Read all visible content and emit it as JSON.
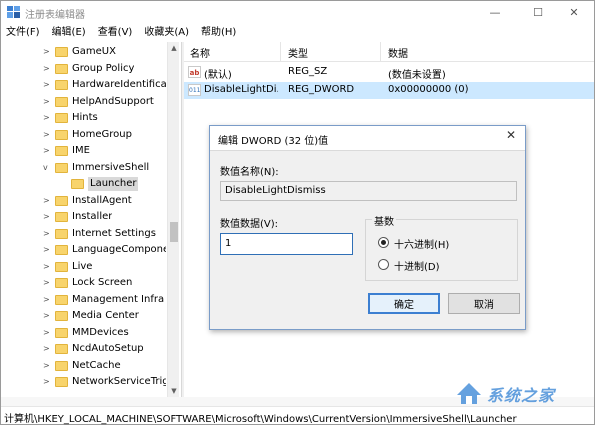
{
  "window": {
    "title": "注册表编辑器",
    "min_glyph": "—",
    "max_glyph": "☐",
    "close_glyph": "✕"
  },
  "menu": [
    "文件(F)",
    "编辑(E)",
    "查看(V)",
    "收藏夹(A)",
    "帮助(H)"
  ],
  "tree": {
    "items": [
      {
        "label": "GameUX",
        "expander": ">",
        "selected": false
      },
      {
        "label": "Group Policy",
        "expander": ">",
        "selected": false
      },
      {
        "label": "HardwareIdentifica",
        "expander": ">",
        "selected": false
      },
      {
        "label": "HelpAndSupport",
        "expander": ">",
        "selected": false
      },
      {
        "label": "Hints",
        "expander": ">",
        "selected": false
      },
      {
        "label": "HomeGroup",
        "expander": ">",
        "selected": false
      },
      {
        "label": "IME",
        "expander": ">",
        "selected": false
      },
      {
        "label": "ImmersiveShell",
        "expander": "v",
        "selected": false
      },
      {
        "label": "Launcher",
        "expander": "",
        "selected": true
      },
      {
        "label": "InstallAgent",
        "expander": ">",
        "selected": false
      },
      {
        "label": "Installer",
        "expander": ">",
        "selected": false
      },
      {
        "label": "Internet Settings",
        "expander": ">",
        "selected": false
      },
      {
        "label": "LanguageCompone",
        "expander": ">",
        "selected": false
      },
      {
        "label": "Live",
        "expander": ">",
        "selected": false
      },
      {
        "label": "Lock Screen",
        "expander": ">",
        "selected": false
      },
      {
        "label": "Management Infra",
        "expander": ">",
        "selected": false
      },
      {
        "label": "Media Center",
        "expander": ">",
        "selected": false
      },
      {
        "label": "MMDevices",
        "expander": ">",
        "selected": false
      },
      {
        "label": "NcdAutoSetup",
        "expander": ">",
        "selected": false
      },
      {
        "label": "NetCache",
        "expander": ">",
        "selected": false
      },
      {
        "label": "NetworkServiceTrig",
        "expander": ">",
        "selected": false
      }
    ]
  },
  "list": {
    "columns": [
      "名称",
      "类型",
      "数据"
    ],
    "rows": [
      {
        "icon": "ab",
        "icon_name": "string-value-icon",
        "name": "(默认)",
        "type": "REG_SZ",
        "data": "(数值未设置)",
        "selected": false
      },
      {
        "icon": "011",
        "icon_name": "dword-value-icon",
        "name": "DisableLightDi...",
        "type": "REG_DWORD",
        "data": "0x00000000 (0)",
        "selected": true
      }
    ]
  },
  "status": {
    "path": "计算机\\HKEY_LOCAL_MACHINE\\SOFTWARE\\Microsoft\\Windows\\CurrentVersion\\ImmersiveShell\\Launcher"
  },
  "dialog": {
    "title": "编辑 DWORD (32 位)值",
    "close_glyph": "✕",
    "name_label": "数值名称(N):",
    "name_value": "DisableLightDismiss",
    "data_label": "数值数据(V):",
    "data_value": "1",
    "base_label": "基数",
    "radios": [
      {
        "label": "十六进制(H)",
        "checked": true
      },
      {
        "label": "十进制(D)",
        "checked": false
      }
    ],
    "ok_label": "确定",
    "cancel_label": "取消"
  },
  "watermark": {
    "text": "系统之家"
  },
  "colors": {
    "selection_blue": "#cce8ff",
    "folder_yellow": "#f8d46c",
    "dialog_border": "#7a9cc8",
    "default_button": "#3c7fd1"
  }
}
